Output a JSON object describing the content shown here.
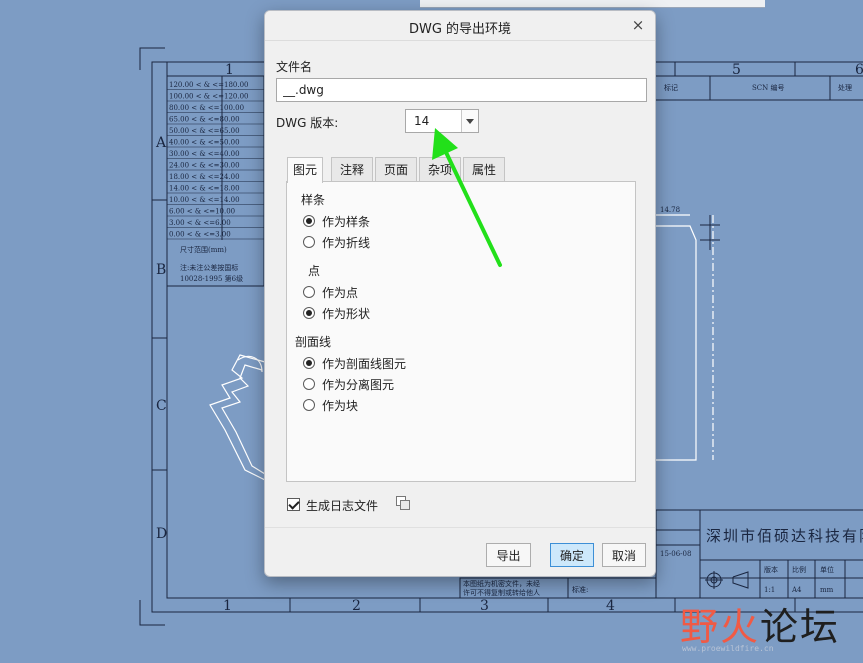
{
  "dialog": {
    "title": "DWG 的导出环境",
    "close_glyph": "×",
    "filename_label": "文件名",
    "filename_value": "__.dwg",
    "version_label": "DWG 版本:",
    "version_value": "14",
    "tabs": [
      {
        "label": "图元",
        "active": true
      },
      {
        "label": "注释",
        "active": false
      },
      {
        "label": "页面",
        "active": false
      },
      {
        "label": "杂项",
        "active": false
      },
      {
        "label": "属性",
        "active": false
      }
    ],
    "groups": {
      "spline": {
        "label": "样条",
        "options": [
          {
            "label": "作为样条",
            "checked": true
          },
          {
            "label": "作为折线",
            "checked": false
          }
        ]
      },
      "point": {
        "label": "点",
        "options": [
          {
            "label": "作为点",
            "checked": false
          },
          {
            "label": "作为形状",
            "checked": true
          }
        ]
      },
      "hatch": {
        "label": "剖面线",
        "options": [
          {
            "label": "作为剖面线图元",
            "checked": true
          },
          {
            "label": "作为分离图元",
            "checked": false
          },
          {
            "label": "作为块",
            "checked": false
          }
        ]
      }
    },
    "log_label": "生成日志文件",
    "log_checked": true,
    "buttons": {
      "export": "导出",
      "ok": "确定",
      "cancel": "取消"
    }
  },
  "drawing": {
    "column_numbers": [
      "1",
      "2",
      "3",
      "4",
      "5",
      "6"
    ],
    "row_letters": [
      "A",
      "B",
      "C",
      "D"
    ],
    "company": "深圳市佰硕达科技有限",
    "dimension": "14.78",
    "tolerance_rows": [
      "120.00 < & <=180.00",
      "100.00 < & <=120.00",
      "80.00 < & <=100.00",
      "65.00 < & <=80.00",
      "50.00 < & <=65.00",
      "40.00 < & <=50.00",
      "30.00 < & <=40.00",
      "24.00 < & <=30.00",
      "18.00 < & <=24.00",
      "14.00 < & <=18.00",
      "10.00 < & <=14.00",
      "6.00 < & <=10.00",
      "3.00 < & <=6.00",
      "0.00 < & <=3.00"
    ],
    "size_header": "尺寸范围(mm)",
    "note_line1": "注:未注公差按国标",
    "note_line2": "10028-1995 第6级",
    "date": "15-06-08",
    "top_headers": [
      "标记",
      "SCN 编号",
      "处理"
    ],
    "bottom_cells": [
      "版本",
      "比例",
      "单位"
    ],
    "bottom_values": [
      "1:1",
      "A4",
      "mm"
    ],
    "footer_note1": "本图纸为机密文件，未经",
    "footer_note2": "许可不得复制或转给他人",
    "footer_label": "标准:"
  },
  "watermark": {
    "brand_colored": "野火",
    "brand_dark": "论坛",
    "url": "www.proewildfire.cn"
  },
  "colors": {
    "background": "#7d9cc4",
    "arrow": "#22e01a",
    "primary_button": "#cde8fb",
    "watermark_red": "#f05a45"
  }
}
